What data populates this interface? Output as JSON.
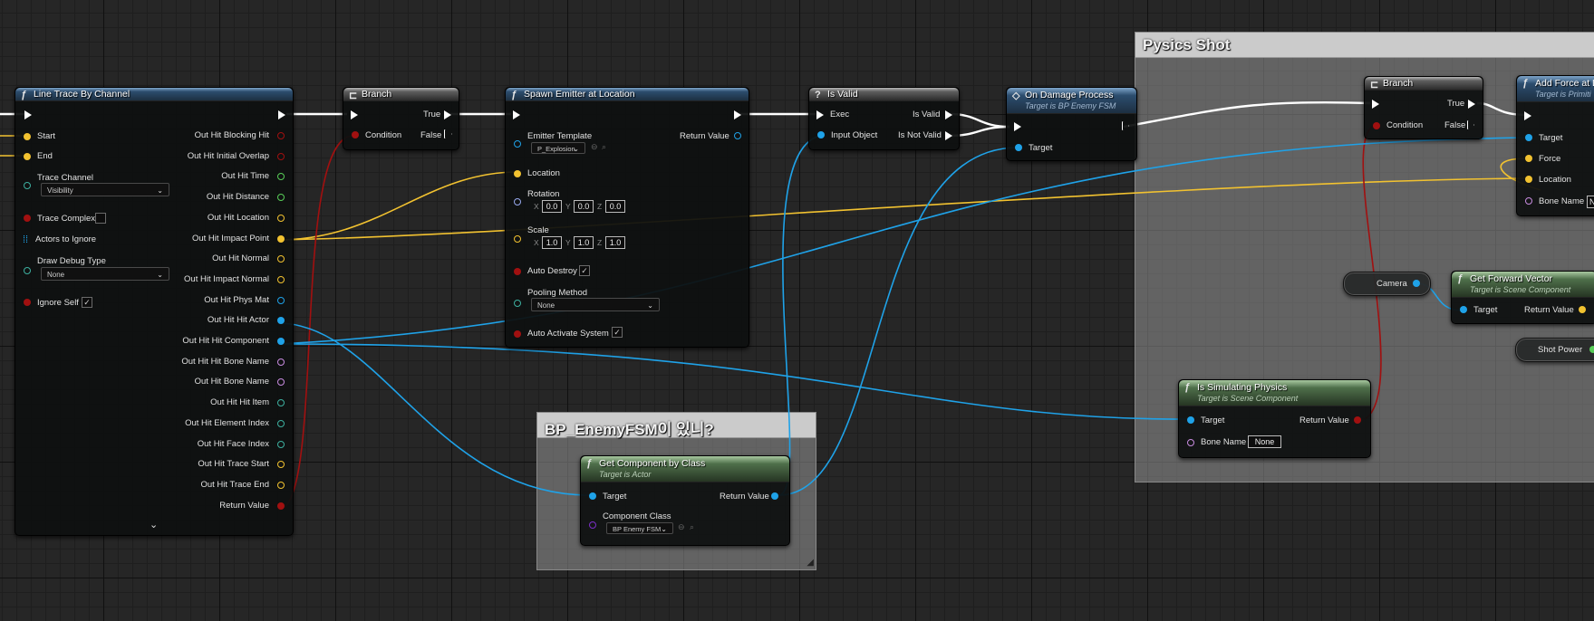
{
  "comments": {
    "physics_shot": "Pysics Shot",
    "enemy_check": "BP_EnemyFSM이 있니?"
  },
  "line_trace": {
    "title": "Line Trace By Channel",
    "inputs": {
      "start": "Start",
      "end": "End",
      "trace_channel": "Trace Channel",
      "trace_channel_value": "Visibility",
      "trace_complex": "Trace Complex",
      "actors_to_ignore": "Actors to Ignore",
      "draw_debug_type": "Draw Debug Type",
      "draw_debug_value": "None",
      "ignore_self": "Ignore Self"
    },
    "outputs": [
      "Out Hit Blocking Hit",
      "Out Hit Initial Overlap",
      "Out Hit Time",
      "Out Hit Distance",
      "Out Hit Location",
      "Out Hit Impact Point",
      "Out Hit Normal",
      "Out Hit Impact Normal",
      "Out Hit Phys Mat",
      "Out Hit Hit Actor",
      "Out Hit Hit Component",
      "Out Hit Hit Bone Name",
      "Out Hit Bone Name",
      "Out Hit Hit Item",
      "Out Hit Element Index",
      "Out Hit Face Index",
      "Out Hit Trace Start",
      "Out Hit Trace End",
      "Return Value"
    ],
    "ignore_self_checked": true,
    "trace_complex_checked": false
  },
  "branch1": {
    "title": "Branch",
    "true_label": "True",
    "false_label": "False",
    "condition": "Condition"
  },
  "spawn_emitter": {
    "title": "Spawn Emitter at Location",
    "emitter_template": "Emitter Template",
    "emitter_value": "P_Explosion",
    "return_value": "Return Value",
    "location": "Location",
    "rotation": "Rotation",
    "rotation_values": [
      "0.0",
      "0.0",
      "0.0"
    ],
    "scale": "Scale",
    "scale_values": [
      "1.0",
      "1.0",
      "1.0"
    ],
    "auto_destroy": "Auto Destroy",
    "pooling_method": "Pooling Method",
    "pooling_value": "None",
    "auto_activate": "Auto Activate System",
    "axis_x": "X",
    "axis_y": "Y",
    "axis_z": "Z"
  },
  "is_valid": {
    "title": "Is Valid",
    "exec": "Exec",
    "is_valid": "Is Valid",
    "input_object": "Input Object",
    "is_not_valid": "Is Not Valid"
  },
  "on_damage": {
    "title": "On Damage Process",
    "subtitle": "Target is BP Enemy FSM",
    "target": "Target"
  },
  "branch2": {
    "title": "Branch",
    "true_label": "True",
    "false_label": "False",
    "condition": "Condition"
  },
  "add_force": {
    "title": "Add Force at L",
    "subtitle": "Target is Primiti",
    "target": "Target",
    "force": "Force",
    "location": "Location",
    "bone_name": "Bone Name",
    "bone_value": "N"
  },
  "camera": {
    "label": "Camera"
  },
  "forward_vector": {
    "title": "Get Forward Vector",
    "subtitle": "Target is Scene Component",
    "target": "Target",
    "return_value": "Return Value"
  },
  "shot_power": {
    "label": "Shot Power"
  },
  "simulating_physics": {
    "title": "Is Simulating Physics",
    "subtitle": "Target is Scene Component",
    "target": "Target",
    "return_value": "Return Value",
    "bone_name": "Bone Name",
    "bone_value": "None"
  },
  "get_component": {
    "title": "Get Component by Class",
    "subtitle": "Target is Actor",
    "target": "Target",
    "return_value": "Return Value",
    "component_class": "Component Class",
    "class_value": "BP Enemy FSM"
  },
  "colors": {
    "exec": "#ffffff",
    "vector": "#f2c230",
    "object": "#1fa2e8",
    "bool": "#a11010",
    "rotator": "#98a9ee",
    "name": "#c88ce0",
    "float": "#58ce58",
    "struct": "#3db0a0"
  }
}
